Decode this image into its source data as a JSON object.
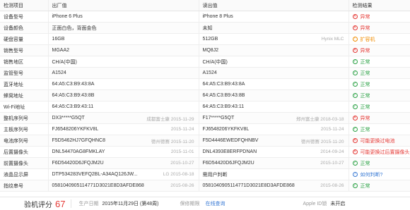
{
  "headers": [
    "检测项目",
    "出厂值",
    "读出值",
    "检测结果"
  ],
  "rows": [
    {
      "label": "设备型号",
      "factory": "iPhone 6 Plus",
      "factory_meta": "",
      "read": "iPhone 8 Plus",
      "read_meta": "",
      "result": "异常",
      "status": "bad"
    },
    {
      "label": "设备颜色",
      "factory": "正面白色，背面金色",
      "factory_meta": "",
      "read": "未知",
      "read_meta": "",
      "result": "异常",
      "status": "bad"
    },
    {
      "label": "硬盘容量",
      "factory": "16GB",
      "factory_meta": "",
      "read": "512GB",
      "read_meta": "Hynix MLC",
      "result": "扩容机",
      "status": "warn"
    },
    {
      "label": "销售型号",
      "factory": "MGAA2",
      "factory_meta": "",
      "read": "MQ8J2",
      "read_meta": "",
      "result": "异常",
      "status": "bad"
    },
    {
      "label": "销售地区",
      "factory": "CH/A(中国)",
      "factory_meta": "",
      "read": "CH/A(中国)",
      "read_meta": "",
      "result": "正常",
      "status": "ok"
    },
    {
      "label": "监管型号",
      "factory": "A1524",
      "factory_meta": "",
      "read": "A1524",
      "read_meta": "",
      "result": "正常",
      "status": "ok"
    },
    {
      "label": "蓝牙地址",
      "factory": "64:A5:C3:B9:43:8A",
      "factory_meta": "",
      "read": "64:A5:C3:B9:43:8A",
      "read_meta": "",
      "result": "正常",
      "status": "ok"
    },
    {
      "label": "蜂窝地址",
      "factory": "64:A5:C3:B9:43:8B",
      "factory_meta": "",
      "read": "64:A5:C3:B9:43:8B",
      "read_meta": "",
      "result": "正常",
      "status": "ok"
    },
    {
      "label": "Wi-Fi地址",
      "factory": "64:A5:C3:B9:43:11",
      "factory_meta": "",
      "read": "64:A5:C3:B9:43:11",
      "read_meta": "",
      "result": "正常",
      "status": "ok"
    },
    {
      "label": "整机序列号",
      "factory": "DX3*****G5QT",
      "factory_meta": "成都富士康   2015-11-29",
      "read": "F17*****G5QT",
      "read_meta": "郑州富士康   2018-03-18",
      "result": "异常",
      "status": "bad"
    },
    {
      "label": "主板序列号",
      "factory": "FJ6548206YKFKV8L",
      "factory_meta": "2015-11-24",
      "read": "FJ6548206YKFKV8L",
      "read_meta": "2015-11-24",
      "result": "正常",
      "status": "ok"
    },
    {
      "label": "电池序列号",
      "factory": "F5D5462HJ7GFQHNC8",
      "factory_meta": "德州德赛   2015-11-20",
      "read": "F5D4446EWEDFQHNBV",
      "read_meta": "德州德赛   2015-11-20",
      "result": "可能更换过电池",
      "status": "bad"
    },
    {
      "label": "后置摄像头",
      "factory": "DNL54470AG8FMKLAY",
      "factory_meta": "2015-11-01",
      "read": "DNL4393E8ERFPDNAN",
      "read_meta": "2014-09-24",
      "result": "可能更换过后置摄像头",
      "status": "bad"
    },
    {
      "label": "前置摄像头",
      "factory": "F6D54420D6JFQJM2U",
      "factory_meta": "2015-10-27",
      "read": "F6D54420D6JFQJM2U",
      "read_meta": "2015-10-27",
      "result": "正常",
      "status": "ok"
    },
    {
      "label": "液晶显示屏",
      "factory": "DTP534283VEFQ2BL-A34AQ126JW...",
      "factory_meta": "LG   2015-08-18",
      "read": "需用户判断",
      "read_meta": "",
      "result": "如何判断?",
      "status": "q"
    },
    {
      "label": "指纹串号",
      "factory": "0581040905114771D3021E8D3AFDE868",
      "factory_meta": "2015-08-26",
      "read": "0581040905114771D3021E8D3AFDE868",
      "read_meta": "2015-08-26",
      "result": "正常",
      "status": "ok"
    }
  ],
  "footer": {
    "score_label": "验机评分",
    "score": "67",
    "production_label": "生产日期",
    "production_value": "2015年11月29日 (第48周)",
    "warranty_label": "保修期限",
    "warranty_link": "在线查询",
    "appleid_label": "Apple ID锁",
    "appleid_value": "未开启"
  },
  "colors": {
    "ok": "#2ba245",
    "bad": "#e53935",
    "warn": "#f08c00",
    "q": "#3a7bd5"
  }
}
